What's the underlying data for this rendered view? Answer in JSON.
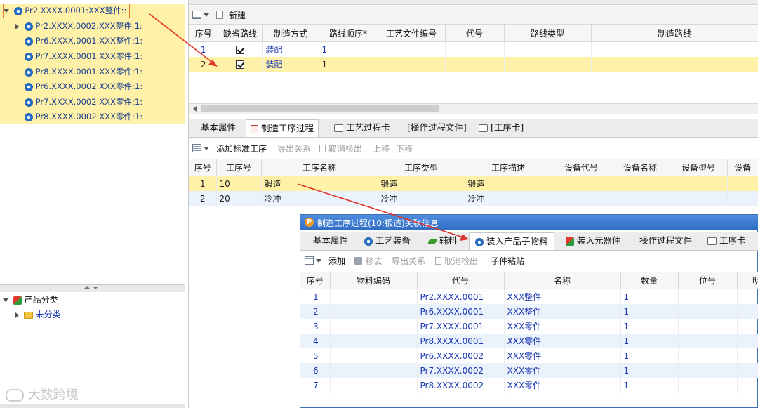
{
  "colors": {
    "highlight": "#fff2a8",
    "link_blue": "#1a37b5",
    "arrow": "#e0352b",
    "dialog_title": "#3b7bd4"
  },
  "tree": {
    "items": [
      {
        "label": "Pr2.XXXX.0001:XXX整件::",
        "expander": "down"
      },
      {
        "label": "Pr2.XXXX.0002:XXX整件:1:",
        "expander": "right"
      },
      {
        "label": "Pr6.XXXX.0001:XXX整件:1:",
        "expander": ""
      },
      {
        "label": "Pr7.XXXX.0001:XXX零件:1:",
        "expander": ""
      },
      {
        "label": "Pr8.XXXX.0001:XXX零件:1:",
        "expander": ""
      },
      {
        "label": "Pr6.XXXX.0002:XXX零件:1:",
        "expander": ""
      },
      {
        "label": "Pr7.XXXX.0002:XXX零件:1:",
        "expander": ""
      },
      {
        "label": "Pr8.XXXX.0002:XXX零件:1:",
        "expander": ""
      }
    ]
  },
  "category_tree": {
    "root": "产品分类",
    "child": "未分类"
  },
  "watermark": "大数跨境",
  "routes": {
    "toolbar": {
      "new": "新建"
    },
    "headers": [
      "序号",
      "缺省路线",
      "制造方式",
      "路线顺序*",
      "工艺文件编号",
      "代号",
      "路线类型",
      "制造路线"
    ],
    "rows": [
      {
        "seq": "1",
        "method": "装配",
        "order": "1"
      },
      {
        "seq": "2",
        "method": "装配",
        "order": "1"
      }
    ]
  },
  "mid_tabs": [
    "基本属性",
    "制造工序过程",
    "工艺过程卡",
    "[操作过程文件]",
    "[工序卡]"
  ],
  "process": {
    "toolbar": {
      "add": "添加标准工序",
      "export": "导出关系",
      "cancel": "取消检出",
      "up": "上移",
      "down": "下移"
    },
    "headers": [
      "序号",
      "工序号",
      "工序名称",
      "工序类型",
      "工序描述",
      "设备代号",
      "设备名称",
      "设备型号",
      "设备"
    ],
    "rows": [
      {
        "seq": "1",
        "no": "10",
        "name": "锻造",
        "type": "锻造",
        "desc": "锻造"
      },
      {
        "seq": "2",
        "no": "20",
        "name": "冷冲",
        "type": "冷冲",
        "desc": "冷冲"
      }
    ]
  },
  "dialog": {
    "title": "制造工序过程(10:锻造)关联信息",
    "tabs": [
      "基本属性",
      "工艺装备",
      "辅料",
      "装入产品子物料",
      "装入元器件",
      "操作过程文件",
      "工序卡"
    ],
    "toolbar": {
      "add": "添加",
      "remove": "移去",
      "export": "导出关系",
      "cancel": "取消检出",
      "paste": "子件粘贴"
    },
    "headers": [
      "序号",
      "物料编码",
      "代号",
      "名称",
      "数量",
      "位号",
      "明细"
    ],
    "rows": [
      {
        "seq": "1",
        "code": "Pr2.XXXX.0001",
        "name": "XXX整件",
        "qty": "1"
      },
      {
        "seq": "2",
        "code": "Pr6.XXXX.0001",
        "name": "XXX整件",
        "qty": "1"
      },
      {
        "seq": "3",
        "code": "Pr7.XXXX.0001",
        "name": "XXX零件",
        "qty": "1"
      },
      {
        "seq": "4",
        "code": "Pr8.XXXX.0001",
        "name": "XXX零件",
        "qty": "1"
      },
      {
        "seq": "5",
        "code": "Pr6.XXXX.0002",
        "name": "XXX零件",
        "qty": "1"
      },
      {
        "seq": "6",
        "code": "Pr7.XXXX.0002",
        "name": "XXX零件",
        "qty": "1"
      },
      {
        "seq": "7",
        "code": "Pr8.XXXX.0002",
        "name": "XXX零件",
        "qty": "1"
      }
    ]
  }
}
